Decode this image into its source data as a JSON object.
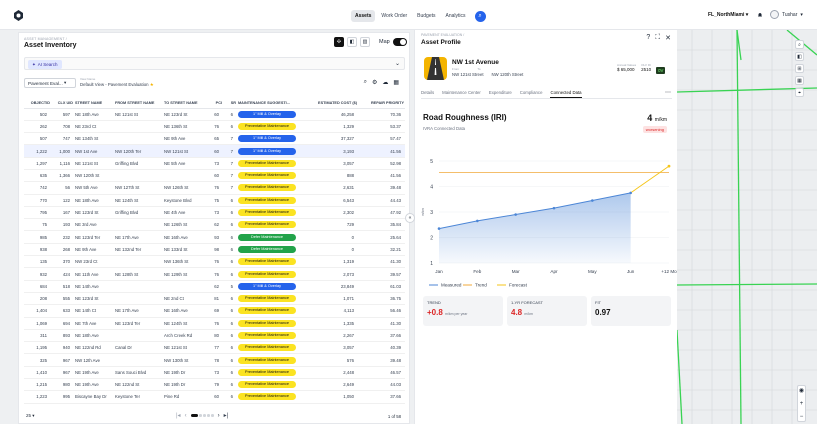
{
  "topbar": {
    "nav": [
      {
        "label": "Assets",
        "active": true
      },
      {
        "label": "Work Order",
        "active": false
      },
      {
        "label": "Budgets",
        "active": false
      },
      {
        "label": "Analytics",
        "active": false
      }
    ],
    "tenant": "FL_NorthMiami",
    "user": "Tushar"
  },
  "left": {
    "breadcrumb": "ASSET MANAGEMENT /",
    "title": "Asset Inventory",
    "map_label": "Map",
    "ai_search": "AI Search",
    "dropdown": "Pavement Eval...",
    "view_label": "View Name",
    "view_value": "Default View - Pavement Evaluation",
    "columns": [
      "OBJECTID",
      "CLX UID",
      "STREET NAME",
      "FROM STREET NAME",
      "TO STREET NAME",
      "PCI",
      "SR",
      "MAINTENANCE SUGGESTI...",
      "ESTIMATED COST ($)",
      "REPAIR PRIORITY"
    ],
    "rows": [
      {
        "c": [
          "502",
          "597",
          "NE 18th Ave",
          "NE 121st St",
          "NE 123rd St",
          "60",
          "6"
        ],
        "m": "1\" Mill & Overlay",
        "t": "blue",
        "cost": "46,258",
        "p": "70.36"
      },
      {
        "c": [
          "262",
          "708",
          "NE 23rd Ct",
          "",
          "NE 136th St",
          "76",
          "6"
        ],
        "m": "Preventative Maintenance",
        "t": "yellow",
        "cost": "1,329",
        "p": "53.37"
      },
      {
        "c": [
          "507",
          "747",
          "NE 134th St",
          "",
          "NE 9th Ave",
          "65",
          "7"
        ],
        "m": "1\" Mill & Overlay",
        "t": "blue",
        "cost": "37,327",
        "p": "57.47"
      },
      {
        "c": [
          "1,222",
          "1,000",
          "NW 1st Ave",
          "NW 120th Ter",
          "NW 121st St",
          "60",
          "7"
        ],
        "m": "1\" Mill & Overlay",
        "t": "blue",
        "cost": "3,193",
        "p": "41.56",
        "sel": true
      },
      {
        "c": [
          "1,297",
          "1,116",
          "NE 121st St",
          "Griffing Blvd",
          "NE 5th Ave",
          "73",
          "7"
        ],
        "m": "Preventative Maintenance",
        "t": "yellow",
        "cost": "3,057",
        "p": "52.98"
      },
      {
        "c": [
          "635",
          "1,366",
          "NW 120th St",
          "",
          "",
          "60",
          "7"
        ],
        "m": "Preventative Maintenance",
        "t": "yellow",
        "cost": "888",
        "p": "41.56"
      },
      {
        "c": [
          "742",
          "56",
          "NW 5th Ave",
          "NW 127th St",
          "NW 126th St",
          "76",
          "7"
        ],
        "m": "Preventative Maintenance",
        "t": "yellow",
        "cost": "2,631",
        "p": "39.48"
      },
      {
        "c": [
          "770",
          "122",
          "NE 18th Ave",
          "NE 124th St",
          "Keystone Blvd",
          "75",
          "6"
        ],
        "m": "Preventative Maintenance",
        "t": "yellow",
        "cost": "6,543",
        "p": "44.43"
      },
      {
        "c": [
          "795",
          "167",
          "NE 123rd St",
          "Griffing Blvd",
          "NE 4th Ave",
          "73",
          "6"
        ],
        "m": "Preventative Maintenance",
        "t": "yellow",
        "cost": "2,302",
        "p": "47.92"
      },
      {
        "c": [
          "75",
          "193",
          "NE 3rd Ave",
          "",
          "NE 126th St",
          "62",
          "6"
        ],
        "m": "Preventative Maintenance",
        "t": "yellow",
        "cost": "729",
        "p": "35.84"
      },
      {
        "c": [
          "985",
          "232",
          "NE 123rd Ter",
          "NE 17th Ave",
          "NE 16th Ave",
          "93",
          "6"
        ],
        "m": "Defer Maintenance",
        "t": "green",
        "cost": "0",
        "p": "25.64"
      },
      {
        "c": [
          "938",
          "268",
          "NE 9th Ave",
          "NE 132nd Ter",
          "NE 133rd St",
          "98",
          "6"
        ],
        "m": "Defer Maintenance",
        "t": "green",
        "cost": "0",
        "p": "32.21"
      },
      {
        "c": [
          "135",
          "370",
          "NW 23rd Ct",
          "",
          "NW 136th St",
          "76",
          "6"
        ],
        "m": "Preventative Maintenance",
        "t": "yellow",
        "cost": "1,319",
        "p": "41.30"
      },
      {
        "c": [
          "932",
          "424",
          "NE 11th Ave",
          "NE 128th St",
          "NE 129th St",
          "76",
          "6"
        ],
        "m": "Preventative Maintenance",
        "t": "yellow",
        "cost": "2,073",
        "p": "39.57"
      },
      {
        "c": [
          "684",
          "518",
          "NE 14th Ave",
          "",
          "",
          "62",
          "5"
        ],
        "m": "1\" Mill & Overlay",
        "t": "blue",
        "cost": "23,849",
        "p": "61.03"
      },
      {
        "c": [
          "208",
          "555",
          "NE 123rd St",
          "",
          "NE 2nd Ct",
          "81",
          "6"
        ],
        "m": "Preventative Maintenance",
        "t": "yellow",
        "cost": "1,071",
        "p": "36.75"
      },
      {
        "c": [
          "1,404",
          "633",
          "NE 14th Ct",
          "NE 17th Ave",
          "NE 16th Ave",
          "69",
          "6"
        ],
        "m": "Preventative Maintenance",
        "t": "yellow",
        "cost": "4,113",
        "p": "56.46"
      },
      {
        "c": [
          "1,069",
          "694",
          "NE 7th Ave",
          "NE 123rd Ter",
          "NE 124th St",
          "76",
          "6"
        ],
        "m": "Preventative Maintenance",
        "t": "yellow",
        "cost": "1,335",
        "p": "41.30"
      },
      {
        "c": [
          "311",
          "893",
          "NE 18th Ave",
          "",
          "Arch Creek Rd",
          "80",
          "6"
        ],
        "m": "Preventative Maintenance",
        "t": "yellow",
        "cost": "2,267",
        "p": "37.66"
      },
      {
        "c": [
          "1,195",
          "940",
          "NE 122nd Rd",
          "Canal Dr",
          "NE 121st St",
          "77",
          "6"
        ],
        "m": "Preventative Maintenance",
        "t": "yellow",
        "cost": "3,057",
        "p": "40.39"
      },
      {
        "c": [
          "325",
          "967",
          "NW 12th Ave",
          "",
          "NW 130th St",
          "78",
          "6"
        ],
        "m": "Preventative Maintenance",
        "t": "yellow",
        "cost": "576",
        "p": "39.48"
      },
      {
        "c": [
          "1,410",
          "967",
          "NE 19th Ave",
          "Sans Souci Blvd",
          "NE 19th Dr",
          "73",
          "6"
        ],
        "m": "Preventative Maintenance",
        "t": "yellow",
        "cost": "2,448",
        "p": "46.57"
      },
      {
        "c": [
          "1,215",
          "980",
          "NE 19th Ave",
          "NE 122nd St",
          "NE 19th Dr",
          "79",
          "6"
        ],
        "m": "Preventative Maintenance",
        "t": "yellow",
        "cost": "2,649",
        "p": "44.03"
      },
      {
        "c": [
          "1,223",
          "995",
          "Biscayne Bay Dr",
          "Keystone Ter",
          "Pine Rd",
          "60",
          "6"
        ],
        "m": "Preventative Maintenance",
        "t": "yellow",
        "cost": "1,050",
        "p": "37.66"
      }
    ],
    "per_page": "25",
    "page_count": "1 of 58"
  },
  "right": {
    "breadcrumb": "PAVEMENT EVALUATION /",
    "title": "Asset Profile",
    "name": "NW 1st Avenue",
    "from_label": "From",
    "to_label": "To",
    "from": "NW 121st Street",
    "to": "NW 120th Street",
    "stats": [
      {
        "k": "Annual Values",
        "v": "$ 65,000"
      },
      {
        "k": "OLV ID",
        "v": "2510"
      },
      {
        "k": "",
        "v": "0V",
        "badge": true
      }
    ],
    "tabs": [
      {
        "label": "Details",
        "active": false
      },
      {
        "label": "Maintenance Center",
        "active": false
      },
      {
        "label": "Expenditure",
        "active": false
      },
      {
        "label": "Compliance",
        "active": false
      },
      {
        "label": "Connected Data",
        "active": true
      }
    ],
    "metric_title": "Road Roughness (IRI)",
    "metric_sub": "IVRA Connected Data",
    "metric_value": "4",
    "metric_unit": "m/km",
    "metric_status": "worsening",
    "cards": [
      {
        "k": "TREND",
        "v": "+0.8",
        "u": "m/km per year",
        "red": true
      },
      {
        "k": "1-YR FORECAST",
        "v": "4.8",
        "u": "m/km",
        "red": true
      },
      {
        "k": "FIT",
        "v": "0.97",
        "u": "",
        "red": false
      }
    ]
  },
  "chart_data": {
    "type": "line",
    "ylabel": "m/km",
    "categories": [
      "Jan",
      "Feb",
      "Mar",
      "Apr",
      "May",
      "Jun",
      "+12 Mo"
    ],
    "ylim": [
      1,
      5
    ],
    "series": [
      {
        "name": "Measured",
        "values": [
          2.35,
          2.65,
          2.9,
          3.15,
          3.45,
          3.75,
          null
        ],
        "color": "#4c86d6"
      },
      {
        "name": "Trend",
        "values": [
          4.55,
          4.55,
          4.55,
          4.55,
          4.55,
          4.55,
          4.55
        ],
        "color": "#f0a93a"
      },
      {
        "name": "Forecast",
        "values": [
          null,
          null,
          null,
          null,
          null,
          3.75,
          4.8
        ],
        "color": "#f5c518"
      }
    ],
    "legend": "bottom-left"
  },
  "colors": {
    "accent": "#2563eb",
    "measured": "#4c86d6",
    "trend": "#f0a93a",
    "forecast": "#f5c518",
    "pm": "#fbe322",
    "defer": "#22a34a"
  }
}
